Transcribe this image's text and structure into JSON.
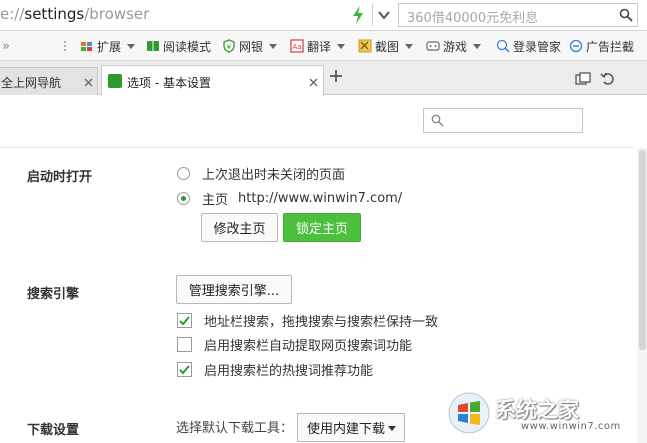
{
  "address_bar": {
    "url_prefix": "e://",
    "url_main": "settings",
    "url_suffix": "/browser",
    "search_placeholder": "360借40000元免利息"
  },
  "toolbar": {
    "items": [
      {
        "label": "扩展",
        "icon": "puzzle-icon"
      },
      {
        "label": "阅读模式",
        "icon": "book-icon"
      },
      {
        "label": "网银",
        "icon": "bank-shield-icon"
      },
      {
        "label": "翻译",
        "icon": "translate-icon"
      },
      {
        "label": "截图",
        "icon": "scissors-icon"
      },
      {
        "label": "游戏",
        "icon": "gamepad-icon"
      },
      {
        "label": "登录管家",
        "icon": "login-key-icon"
      },
      {
        "label": "广告拦截",
        "icon": "ad-block-icon"
      }
    ]
  },
  "tabs": {
    "inactive_label": "全上网导航",
    "active_label": "选项 - 基本设置"
  },
  "settings": {
    "startup": {
      "title": "启动时打开",
      "option_last": "上次退出时未关闭的页面",
      "option_home": "主页",
      "home_url": "http://www.winwin7.com/",
      "btn_modify": "修改主页",
      "btn_lock": "锁定主页",
      "selected": "home"
    },
    "search_engine": {
      "title": "搜索引擎",
      "manage_btn": "管理搜索引擎...",
      "options": [
        {
          "label": "地址栏搜索，拖拽搜索与搜索栏保持一致",
          "checked": true
        },
        {
          "label": "启用搜索栏自动提取网页搜索词功能",
          "checked": false
        },
        {
          "label": "启用搜索栏的热搜词推荐功能",
          "checked": true
        }
      ]
    },
    "download": {
      "title": "下载设置",
      "label": "选择默认下载工具：",
      "selected": "使用内建下载"
    }
  },
  "watermark": {
    "text": "系统之家",
    "domain": "www.winwin7.com"
  },
  "colors": {
    "accent_green": "#4cbf3c",
    "check_green": "#2e9a2e"
  }
}
